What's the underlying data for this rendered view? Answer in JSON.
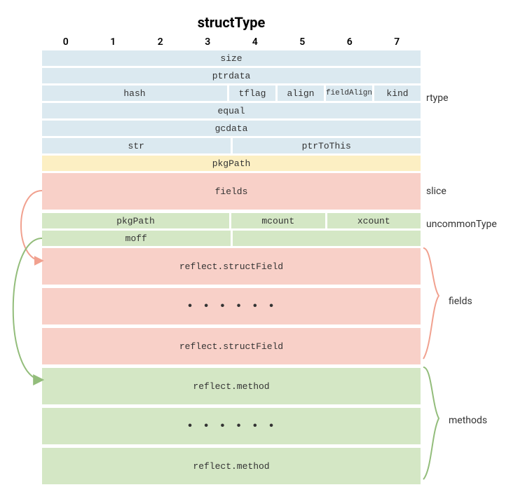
{
  "title": "structType",
  "cols": [
    "0",
    "1",
    "2",
    "3",
    "4",
    "5",
    "6",
    "7"
  ],
  "groups": {
    "rtype_label": "rtype",
    "slice_label": "slice",
    "uncommon_label": "uncommonType",
    "fields_label": "fields",
    "methods_label": "methods"
  },
  "rows": {
    "size": "size",
    "ptrdata": "ptrdata",
    "hash": "hash",
    "tflag": "tflag",
    "align": "align",
    "fieldAlign": "fieldAlign",
    "kind": "kind",
    "equal": "equal",
    "gcdata": "gcdata",
    "str": "str",
    "ptrToThis": "ptrToThis",
    "pkgPath": "pkgPath",
    "fields": "fields",
    "u_pkgPath": "pkgPath",
    "mcount": "mcount",
    "xcount": "xcount",
    "moff": "moff",
    "structField": "reflect.structField",
    "method": "reflect.method",
    "dots": "• • • • • •"
  }
}
